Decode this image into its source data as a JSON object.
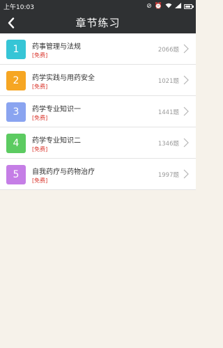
{
  "status_bar": {
    "time": "上午10:03",
    "icons": [
      "dnd-icon",
      "alarm-icon",
      "wifi-icon",
      "signal-icon",
      "battery-icon"
    ]
  },
  "header": {
    "title": "章节练习",
    "back_icon": "chevron-left-icon"
  },
  "chapters": [
    {
      "number": "1",
      "name": "药事管理与法规",
      "tag": "[免费]",
      "count": "2066题",
      "color": "#36c5d6"
    },
    {
      "number": "2",
      "name": "药学实践与用药安全",
      "tag": "[免费]",
      "count": "1021题",
      "color": "#f6a623"
    },
    {
      "number": "3",
      "name": "药学专业知识一",
      "tag": "[免费]",
      "count": "1441题",
      "color": "#8aa4f0"
    },
    {
      "number": "4",
      "name": "药学专业知识二",
      "tag": "[免费]",
      "count": "1346题",
      "color": "#5ccb61"
    },
    {
      "number": "5",
      "name": "自我药疗与药物治疗",
      "tag": "[免费]",
      "count": "1997题",
      "color": "#c57ee6"
    }
  ],
  "colors": {
    "header_bg": "#2f3133",
    "page_bg": "#f6f2ea",
    "free_tag": "#d9342b"
  }
}
